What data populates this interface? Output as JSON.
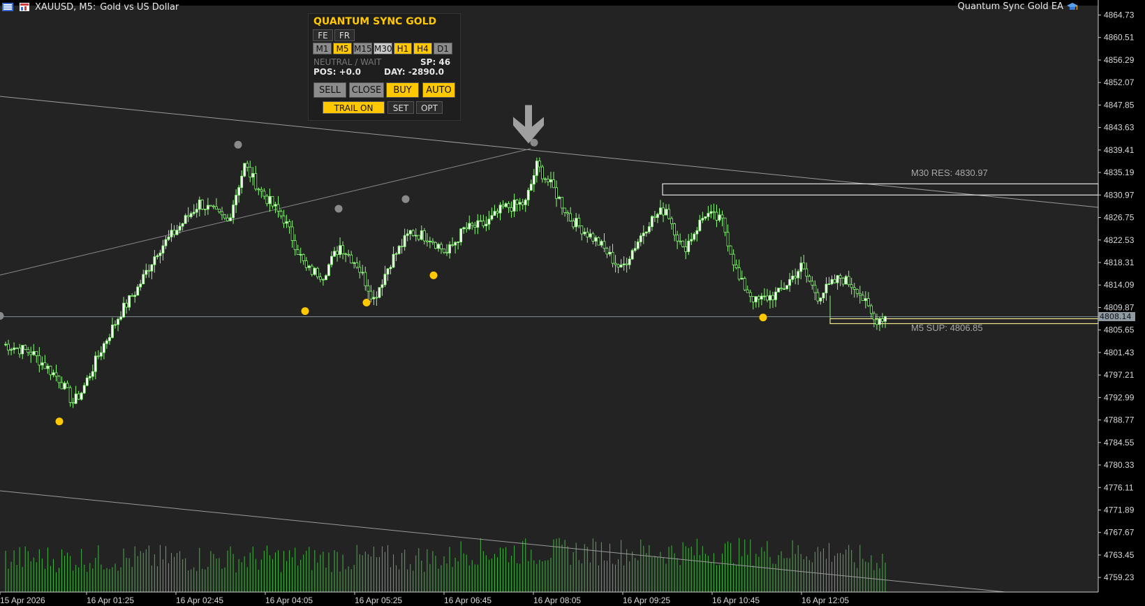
{
  "title_bar": {
    "symbol": "XAUUSD, M5:",
    "description": "Gold vs US Dollar",
    "ea_name": "Quantum Sync Gold EA"
  },
  "panel": {
    "title": "QUANTUM SYNC GOLD",
    "lang_buttons": [
      "FE",
      "FR"
    ],
    "timeframes": [
      {
        "label": "M1",
        "state": "gray"
      },
      {
        "label": "M5",
        "state": "gold"
      },
      {
        "label": "M15",
        "state": "gray"
      },
      {
        "label": "M30",
        "state": "light"
      },
      {
        "label": "H1",
        "state": "gold"
      },
      {
        "label": "H4",
        "state": "gold"
      },
      {
        "label": "D1",
        "state": "gray"
      }
    ],
    "signal": "NEUTRAL / WAIT",
    "spread": "SP: 46",
    "position": "POS: +0.0",
    "day": "DAY: -2890.0",
    "actions": [
      "SELL",
      "CLOSE",
      "BUY",
      "AUTO"
    ],
    "trail": "TRAIL ON",
    "set": "SET",
    "opt": "OPT"
  },
  "levels": {
    "resistance_label": "M30 RES: 4830.97",
    "support_label": "M5 SUP: 4806.85",
    "current_price": "4808.14"
  },
  "colors": {
    "background": "#000000",
    "plot_area": "#232323",
    "bull": "#8cff78",
    "gold": "#ffc800",
    "neutral_dot": "#8a8a8a"
  },
  "chart_data": {
    "type": "candlestick",
    "y_ticks": [
      "4864.73",
      "4860.51",
      "4856.29",
      "4852.07",
      "4847.85",
      "4843.63",
      "4839.41",
      "4835.19",
      "4830.97",
      "4826.75",
      "4822.53",
      "4818.31",
      "4814.09",
      "4809.87",
      "4805.65",
      "4801.43",
      "4797.21",
      "4792.99",
      "4788.77",
      "4784.55",
      "4780.33",
      "4776.11",
      "4771.89",
      "4767.67",
      "4763.45",
      "4759.23"
    ],
    "x_ticks": [
      "15 Apr 2026",
      "16 Apr 01:25",
      "16 Apr 02:45",
      "16 Apr 04:05",
      "16 Apr 05:25",
      "16 Apr 06:45",
      "16 Apr 08:05",
      "16 Apr 09:25",
      "16 Apr 10:45",
      "16 Apr 12:05"
    ],
    "ylim": [
      4756.5,
      4866.5
    ],
    "bar_count": 195,
    "price_path": [
      [
        0,
        4803.0
      ],
      [
        10,
        4801.5
      ],
      [
        20,
        4796.5
      ],
      [
        25,
        4792.0
      ],
      [
        28,
        4794.0
      ],
      [
        35,
        4802.0
      ],
      [
        42,
        4809.0
      ],
      [
        48,
        4813.5
      ],
      [
        55,
        4820.5
      ],
      [
        62,
        4824.5
      ],
      [
        70,
        4829.5
      ],
      [
        80,
        4826.0
      ],
      [
        86,
        4836.5
      ],
      [
        92,
        4831.5
      ],
      [
        100,
        4826.5
      ],
      [
        108,
        4817.0
      ],
      [
        114,
        4816.0
      ],
      [
        120,
        4821.5
      ],
      [
        126,
        4818.0
      ],
      [
        132,
        4811.5
      ],
      [
        138,
        4818.5
      ],
      [
        145,
        4824.0
      ],
      [
        152,
        4823.0
      ],
      [
        158,
        4820.0
      ],
      [
        164,
        4824.5
      ],
      [
        172,
        4825.5
      ],
      [
        178,
        4828.5
      ],
      [
        186,
        4829.5
      ],
      [
        190,
        4836.5
      ],
      [
        196,
        4832.0
      ],
      [
        202,
        4826.5
      ],
      [
        212,
        4822.0
      ],
      [
        220,
        4817.0
      ],
      [
        230,
        4826.0
      ],
      [
        236,
        4828.5
      ],
      [
        242,
        4820.5
      ],
      [
        250,
        4827.5
      ],
      [
        256,
        4826.0
      ],
      [
        262,
        4815.0
      ],
      [
        268,
        4811.0
      ],
      [
        276,
        4812.5
      ],
      [
        284,
        4817.5
      ],
      [
        290,
        4812.0
      ],
      [
        298,
        4815.5
      ],
      [
        304,
        4813.5
      ],
      [
        310,
        4807.5
      ],
      [
        314,
        4808.2
      ]
    ],
    "resistance": 4830.97,
    "support": 4806.85,
    "current_price": 4808.14,
    "gold_dots": [
      [
        12,
        4788.5
      ],
      [
        108,
        4809.2
      ],
      [
        130,
        4810.8
      ],
      [
        154,
        4815.9
      ],
      [
        271,
        4808.0
      ]
    ],
    "gray_dots": [
      [
        0,
        4808.3
      ],
      [
        84,
        4840.4
      ],
      [
        120,
        4828.4
      ],
      [
        144,
        4830.2
      ],
      [
        190,
        4840.8
      ]
    ],
    "down_arrow": {
      "bar": 188,
      "price": 4840.9
    }
  }
}
